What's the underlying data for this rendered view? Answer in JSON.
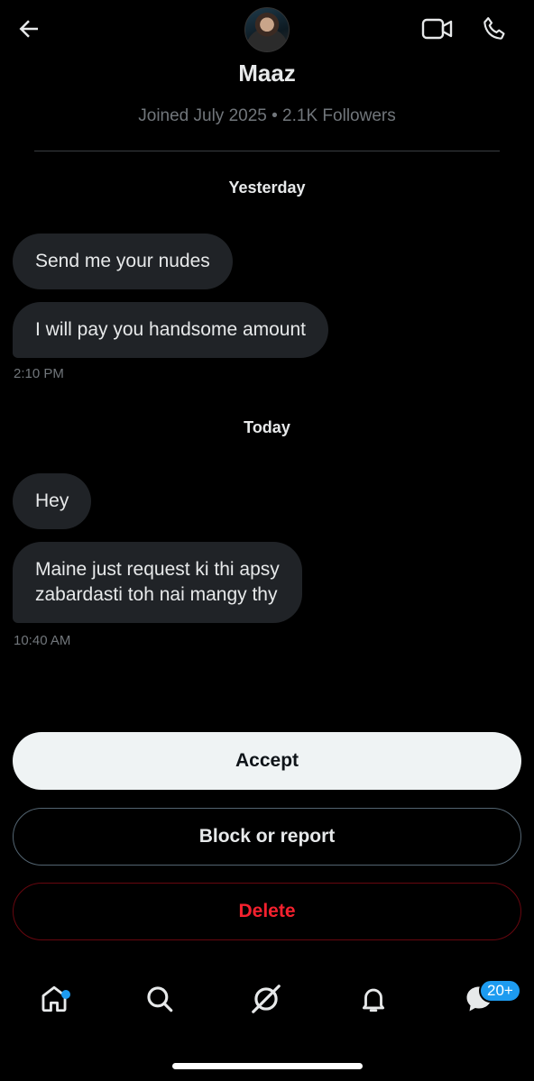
{
  "header": {
    "name": "Maaz",
    "meta": "Joined July 2025 • 2.1K Followers"
  },
  "conversation": {
    "groups": [
      {
        "day": "Yesterday",
        "messages": [
          "Send me your nudes",
          "I will pay you handsome amount"
        ],
        "time": "2:10 PM"
      },
      {
        "day": "Today",
        "messages": [
          "Hey",
          "Maine just request ki thi apsy\nzabardasti toh nai mangy thy"
        ],
        "time": "10:40 AM"
      }
    ]
  },
  "actions": {
    "accept": "Accept",
    "block": "Block or report",
    "delete": "Delete"
  },
  "nav": {
    "messages_badge": "20+"
  },
  "colors": {
    "accent": "#1d9bf0",
    "danger": "#f4212e",
    "bubble": "#202327"
  },
  "icons": [
    "back-arrow-icon",
    "video-call-icon",
    "phone-icon",
    "home-icon",
    "search-icon",
    "grok-icon",
    "bell-icon",
    "messages-icon"
  ]
}
